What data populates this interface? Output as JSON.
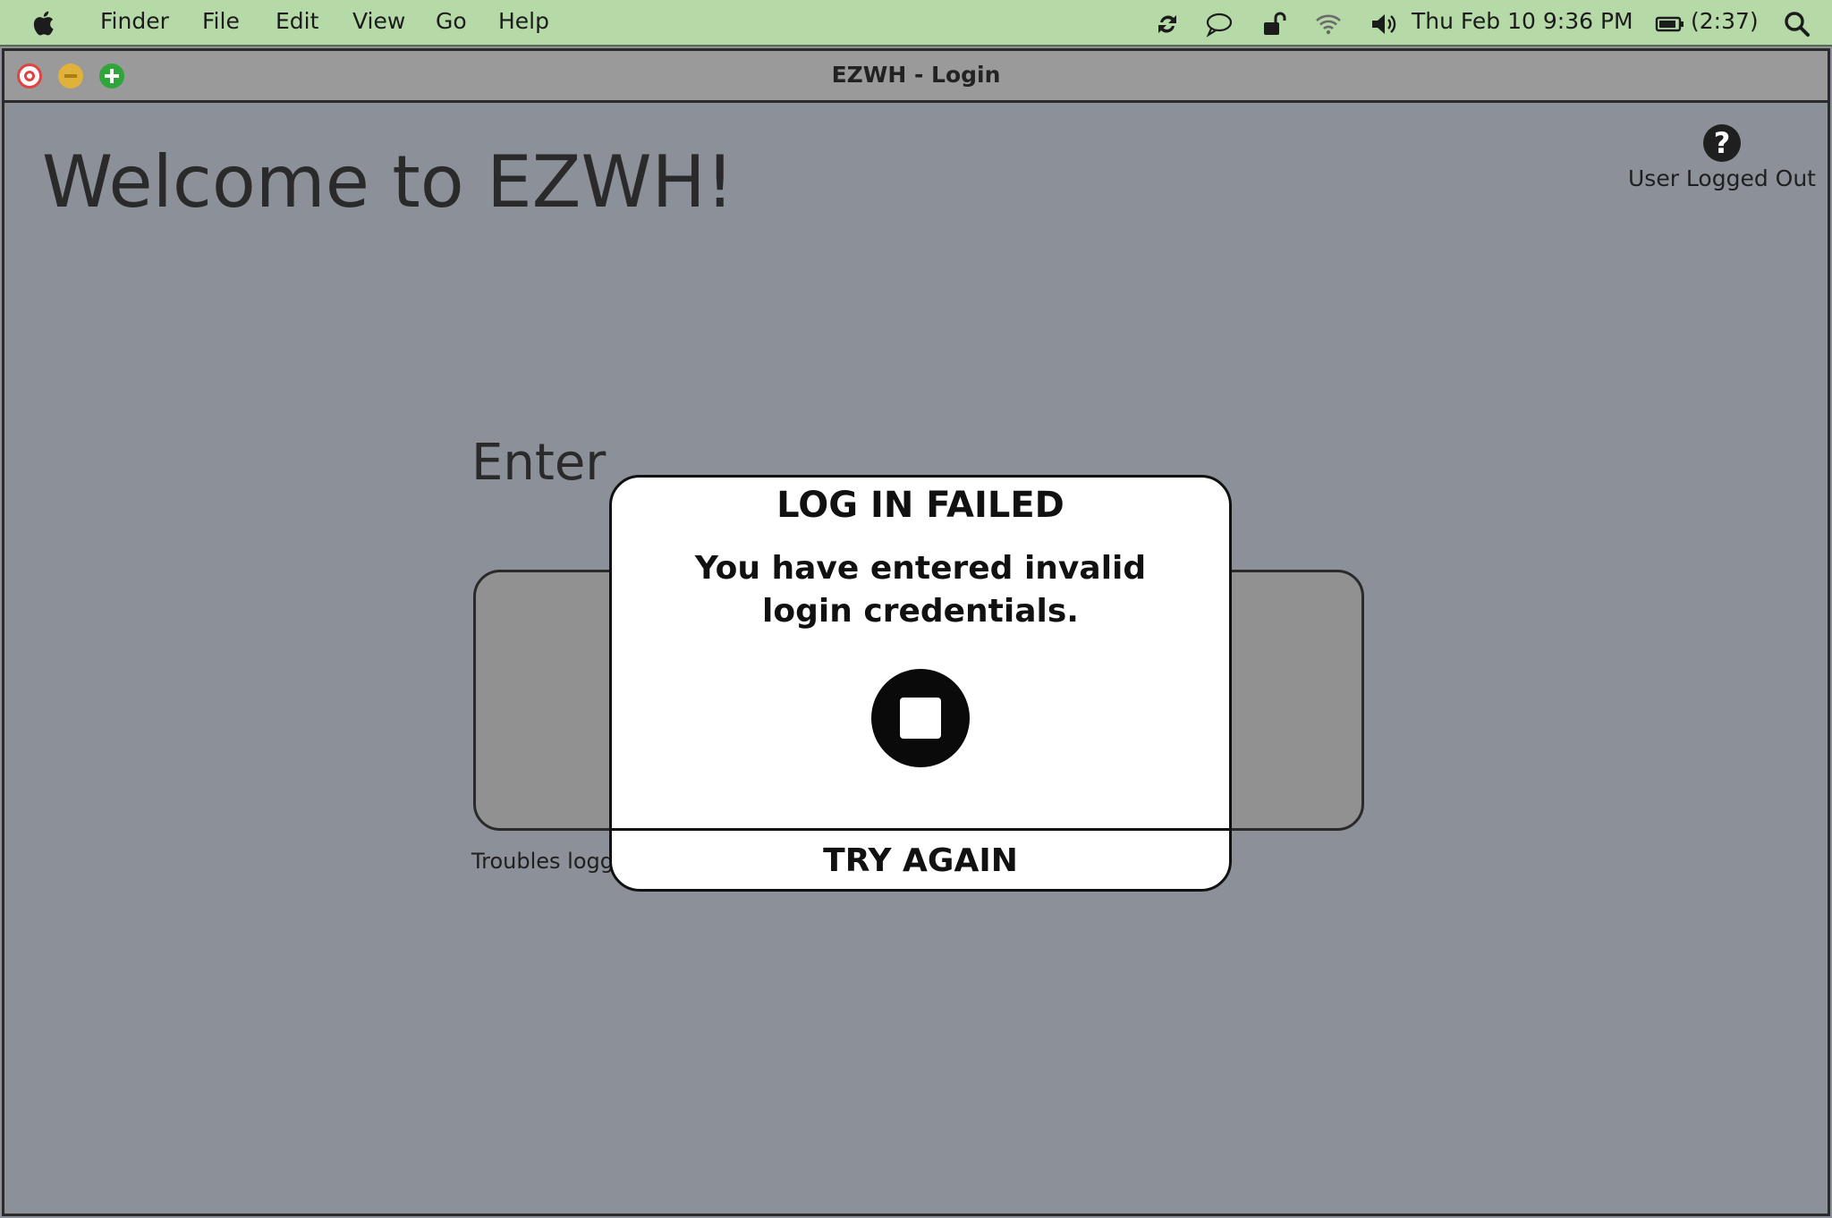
{
  "menubar": {
    "items": [
      "Finder",
      "File",
      "Edit",
      "View",
      "Go",
      "Help"
    ],
    "date_time": "Thu Feb 10  9:36 PM",
    "battery": "(2:37)"
  },
  "window": {
    "title": "EZWH - Login"
  },
  "page": {
    "welcome": "Welcome to EZWH!",
    "enter_label": "Enter",
    "troubles_text": "Troubles logg",
    "user_status": "User Logged Out",
    "help_glyph": "?"
  },
  "modal": {
    "title": "LOG IN FAILED",
    "message": "You have entered invalid login credentials.",
    "button": "TRY AGAIN",
    "icon": "stop-icon"
  },
  "colors": {
    "menubar_bg": "#b6d9a8",
    "window_bg": "#8b9099",
    "close": "#e04343",
    "minimize": "#e0b23a",
    "maximize": "#2fa53a"
  }
}
